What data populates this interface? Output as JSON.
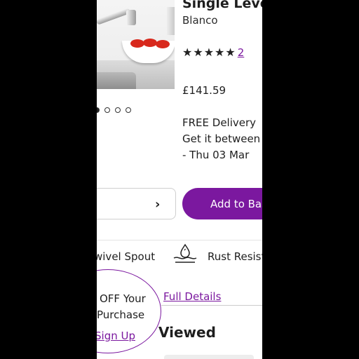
{
  "product": {
    "title": "Single Lever",
    "brand": "Blanco",
    "rating": 5,
    "review_count": "2",
    "price": "£141.59",
    "gallery": {
      "images": 5,
      "active_index": 0
    }
  },
  "delivery": {
    "line1": "FREE Delivery",
    "line2": "Get it between Tu",
    "line3": "- Thu 03 Mar"
  },
  "actions": {
    "chevron": "›",
    "add_to_basket": "Add to Bas"
  },
  "features": [
    {
      "label": "wivel Spout"
    },
    {
      "icon": "water-drop-icon",
      "label": "Rust Resisto"
    }
  ],
  "links": {
    "full_details": "Full Details"
  },
  "sections": {
    "recently_viewed": "Viewed"
  },
  "promo": {
    "line1": "OFF Your",
    "line2": "Purchase",
    "link": "Sign Up"
  },
  "colors": {
    "accent": "#7b189f",
    "text": "#1e1e1e",
    "background": "#ffffff"
  }
}
